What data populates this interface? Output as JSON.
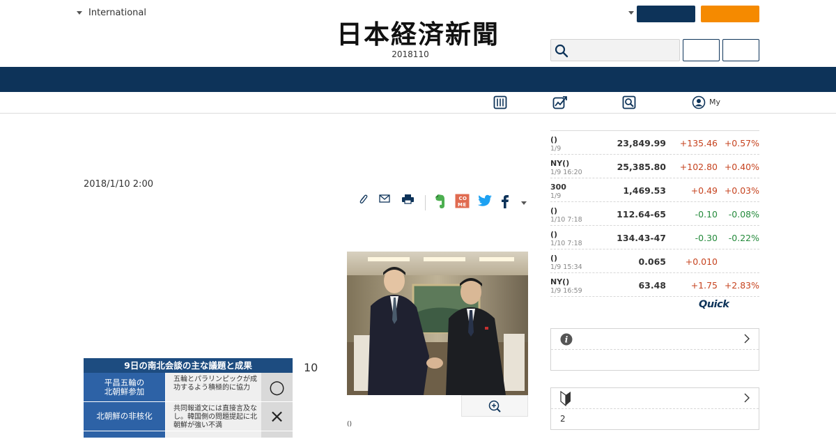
{
  "header": {
    "edition_label": "International",
    "masthead": "日本経済新聞",
    "issue_date": "2018110"
  },
  "subnav": {
    "my_label": "My"
  },
  "article": {
    "date": "2018/1/10 2:00",
    "body_number": "10",
    "photo_caption": "()",
    "infographic": {
      "title": "9日の南北会談の主な議題と成果",
      "rows": [
        {
          "topic_line1": "平昌五輪の",
          "topic_line2": "北朝鮮参加",
          "detail": "五輪とパラリンピックが成功するよう積極的に協力",
          "mark": "○"
        },
        {
          "topic_line1": "北朝鮮の非核化",
          "topic_line2": "",
          "detail": "共同報道文には直接言及なし。韓国側の問題提起に北朝鮮が強い不満",
          "mark": "×"
        }
      ]
    }
  },
  "market": {
    "rows": [
      {
        "name": "()",
        "time": "1/9",
        "value": "23,849.99",
        "change": "+135.46",
        "pct": "+0.57%",
        "dir": "up"
      },
      {
        "name": "NY()",
        "time": "1/9 16:20",
        "value": "25,385.80",
        "change": "+102.80",
        "pct": "+0.40%",
        "dir": "up"
      },
      {
        "name": "300",
        "time": "1/9",
        "value": "1,469.53",
        "change": "+0.49",
        "pct": "+0.03%",
        "dir": "up"
      },
      {
        "name": "()",
        "time": "1/10 7:18",
        "value": "112.64-65",
        "change": "-0.10",
        "pct": "-0.08%",
        "dir": "down"
      },
      {
        "name": "()",
        "time": "1/10 7:18",
        "value": "134.43-47",
        "change": "-0.30",
        "pct": "-0.22%",
        "dir": "down"
      },
      {
        "name": "()",
        "time": "1/9 15:34",
        "value": "0.065",
        "change": "+0.010",
        "pct": "",
        "dir": "up"
      },
      {
        "name": "NY()",
        "time": "1/9 16:59",
        "value": "63.48",
        "change": "+1.75",
        "pct": "+2.83%",
        "dir": "up"
      }
    ],
    "quick_logo": "Quick"
  },
  "side_boxes": {
    "box1_body": "",
    "box2_body": "2"
  },
  "colors": {
    "navy": "#0d3359",
    "orange": "#f58a00",
    "up": "#c6431f",
    "down": "#248a3b"
  },
  "icons": {
    "edition": "caret-down-icon",
    "search": "search-icon",
    "subnav": [
      "newspaper-icon",
      "chart-icon",
      "search-icon",
      "user-icon"
    ],
    "share": [
      "clip-icon",
      "mail-icon",
      "print-icon",
      "evernote-icon",
      "comment-icon",
      "twitter-icon",
      "facebook-icon",
      "caret-down-icon"
    ],
    "zoom": "zoom-in-icon",
    "box1": "info-icon",
    "box2": "beginner-icon"
  }
}
